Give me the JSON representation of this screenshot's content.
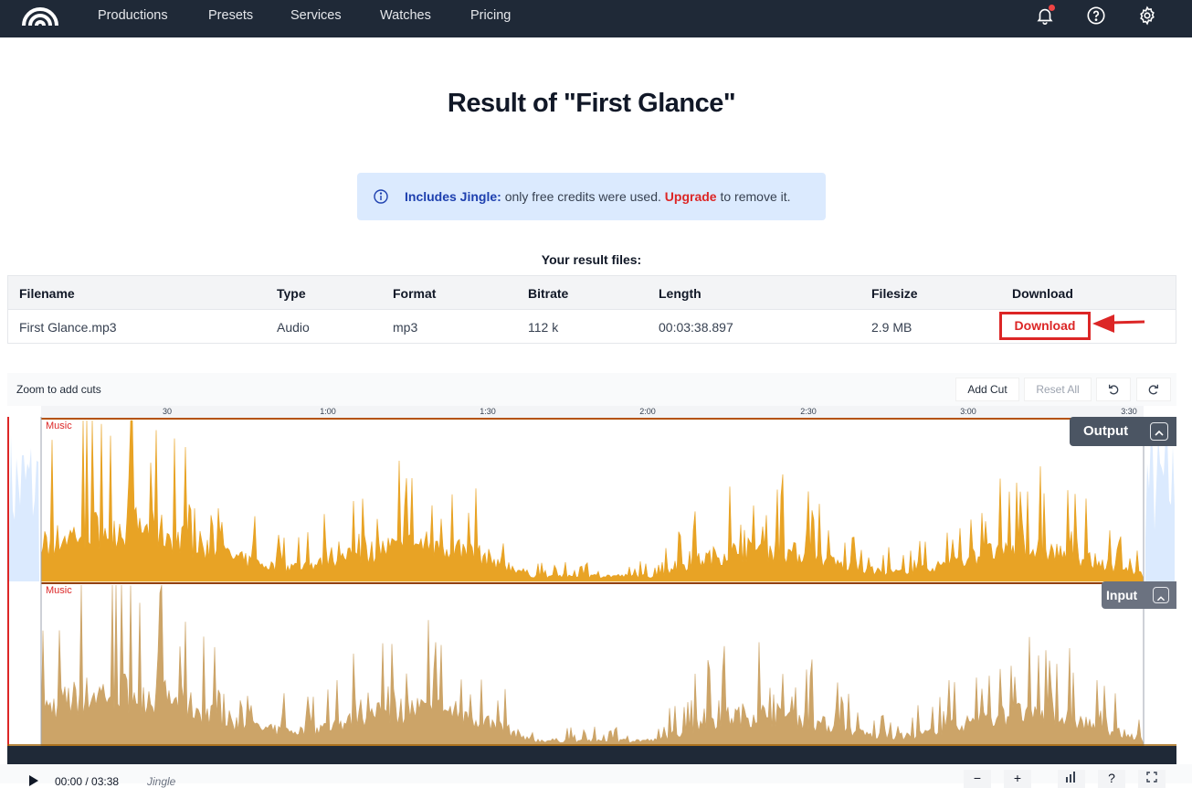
{
  "nav": {
    "items": [
      "Productions",
      "Presets",
      "Services",
      "Watches",
      "Pricing"
    ],
    "icons": [
      "bell-icon",
      "help-icon",
      "gear-icon"
    ]
  },
  "page": {
    "title": "Result of \"First Glance\""
  },
  "info": {
    "strong": "Includes Jingle:",
    "text": " only free credits were used. ",
    "link": "Upgrade",
    "suffix": " to remove it."
  },
  "files": {
    "label": "Your result files:",
    "columns": [
      "Filename",
      "Type",
      "Format",
      "Bitrate",
      "Length",
      "Filesize",
      "Download"
    ],
    "rows": [
      [
        "First Glance.mp3",
        "Audio",
        "mp3",
        "112 k",
        "00:03:38.897",
        "2.9 MB",
        "Download"
      ]
    ]
  },
  "editor": {
    "zoom_label": "Zoom to add cuts",
    "add_cut": "Add Cut",
    "reset_all": "Reset All",
    "ticks": [
      "30",
      "1:00",
      "1:30",
      "2:00",
      "2:30",
      "3:00",
      "3:30"
    ],
    "output_label": "Output",
    "input_label": "Input",
    "track_label": "Music",
    "colors": {
      "output_wave": "#e8a325",
      "input_wave": "#cca468",
      "marker": "#dc2626",
      "background_wave": "#dbeafe"
    }
  },
  "player": {
    "time": "00:00 / 03:38",
    "track": "Jingle",
    "buttons": [
      "−",
      "+",
      "?"
    ]
  }
}
